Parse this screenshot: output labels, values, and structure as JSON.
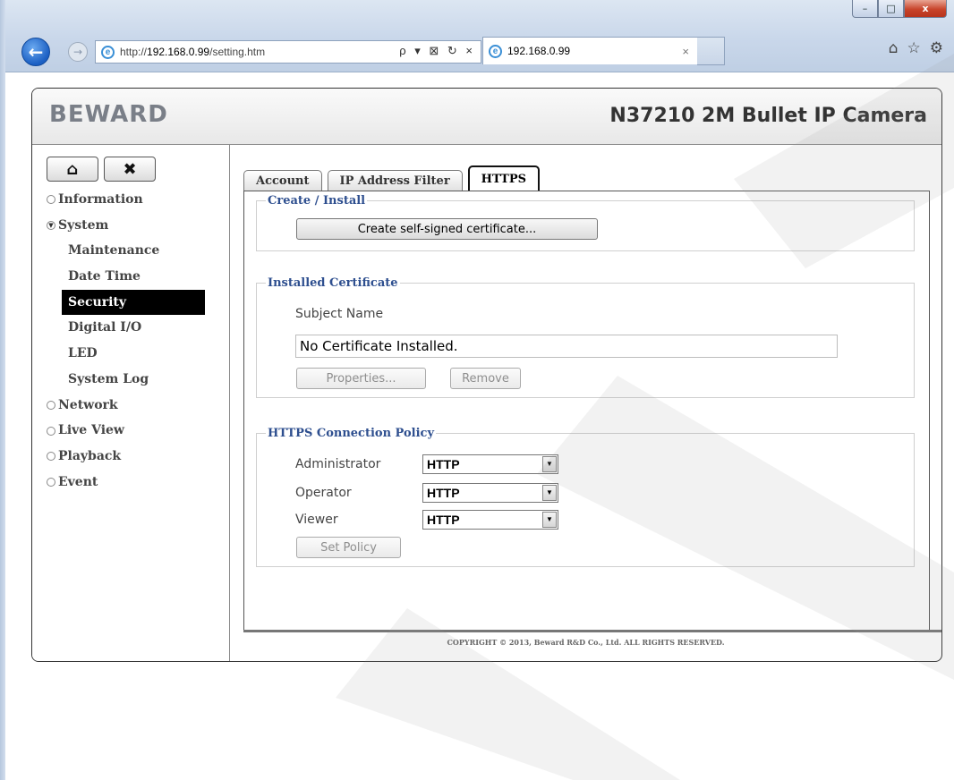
{
  "browser": {
    "url_prefix": "http://",
    "url_host": "192.168.0.99",
    "url_path": "/setting.htm",
    "tab_title": "192.168.0.99",
    "addr_tools": "ρ ▾ ⊠ ↻ ×",
    "tab_close": "×",
    "window_buttons": {
      "minimize": "–",
      "maximize": "□",
      "close": "x"
    }
  },
  "header": {
    "logo": "BEWARD",
    "model": "N37210 2M Bullet IP Camera"
  },
  "sidebar": {
    "menu": [
      {
        "label": "Information"
      },
      {
        "label": "System"
      },
      {
        "label": "Network"
      },
      {
        "label": "Live View"
      },
      {
        "label": "Playback"
      },
      {
        "label": "Event"
      }
    ],
    "system_sub": [
      {
        "label": "Maintenance"
      },
      {
        "label": "Date Time"
      },
      {
        "label": "Security"
      },
      {
        "label": "Digital I/O"
      },
      {
        "label": "LED"
      },
      {
        "label": "System Log"
      }
    ]
  },
  "tabs": [
    {
      "label": "Account"
    },
    {
      "label": "IP Address Filter"
    },
    {
      "label": "HTTPS"
    }
  ],
  "create_install": {
    "legend": "Create / Install",
    "create_button": "Create self-signed certificate..."
  },
  "installed_certificate": {
    "legend": "Installed Certificate",
    "subject_label": "Subject Name",
    "subject_value": "No Certificate Installed.",
    "properties_button": "Properties...",
    "remove_button": "Remove"
  },
  "policy": {
    "legend": "HTTPS Connection Policy",
    "rows": [
      {
        "label": "Administrator",
        "value": "HTTP"
      },
      {
        "label": "Operator",
        "value": "HTTP"
      },
      {
        "label": "Viewer",
        "value": "HTTP"
      }
    ],
    "set_button": "Set Policy"
  },
  "footer": {
    "copyright": "COPYRIGHT © 2013, Beward R&D Co., Ltd. ALL RIGHTS RESERVED."
  }
}
